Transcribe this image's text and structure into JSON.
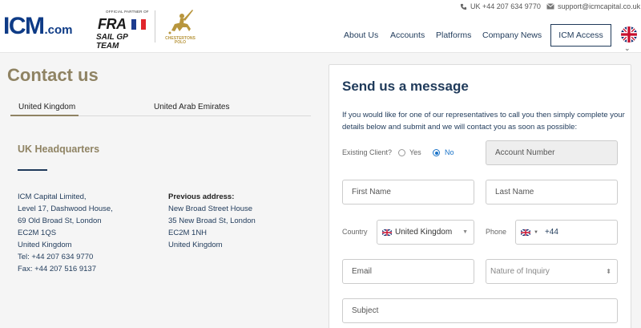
{
  "header": {
    "logo_main": "ICM",
    "logo_sub": ".com",
    "partner": {
      "tiny": "OFFICIAL PARTNER OF",
      "fra": "FRA",
      "sail": "SAIL GP TEAM"
    },
    "polo_text": "CHESTERTONS POLO",
    "phone": "UK +44 207 634 9770",
    "email": "support@icmcapital.co.uk",
    "nav": [
      "About Us",
      "Accounts",
      "Platforms",
      "Company News"
    ],
    "access_label": "ICM Access",
    "chevron": "⌄"
  },
  "left": {
    "title": "Contact us",
    "tabs": [
      "United Kingdom",
      "United Arab Emirates"
    ],
    "hq_title": "UK Headquarters",
    "address": [
      "ICM Capital Limited,",
      "Level 17, Dashwood House,",
      "69 Old Broad St, London",
      "EC2M 1QS",
      "United Kingdom",
      "Tel: +44 207 634 9770",
      "Fax: +44 207 516 9137"
    ],
    "previous_label": "Previous address:",
    "previous": [
      "New Broad Street House",
      "35 New Broad St, London",
      "EC2M 1NH",
      "United Kingdom"
    ]
  },
  "form": {
    "title": "Send us a message",
    "intro": "If you would like for one of our representatives to call you then simply complete your details below and submit and we will contact you as soon as possible:",
    "existing_client_label": "Existing Client?",
    "yes_label": "Yes",
    "no_label": "No",
    "account_number_placeholder": "Account Number",
    "first_name_placeholder": "First Name",
    "last_name_placeholder": "Last Name",
    "country_label": "Country",
    "country_value": "United Kingdom",
    "phone_label": "Phone",
    "phone_code": "+44",
    "email_placeholder": "Email",
    "inquiry_placeholder": "Nature of Inquiry",
    "subject_placeholder": "Subject"
  },
  "colors": {
    "brand_navy": "#1f3a5a",
    "accent_gold": "#8f8363",
    "logo_blue": "#0e3b86",
    "radio_blue": "#1a73c8"
  }
}
